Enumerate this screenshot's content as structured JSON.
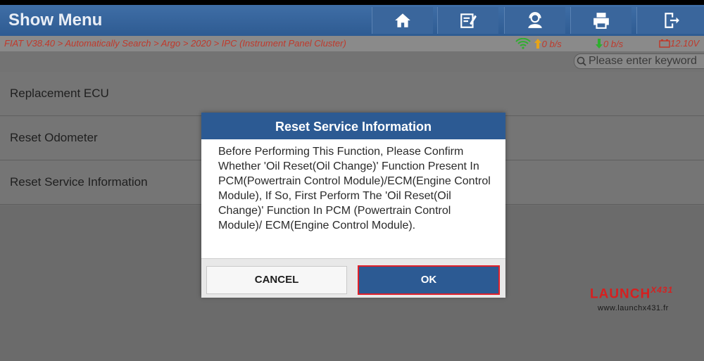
{
  "header": {
    "title": "Show Menu",
    "buttons": [
      "home-icon",
      "edit-icon",
      "user-icon",
      "print-icon",
      "exit-icon"
    ]
  },
  "breadcrumb": "FIAT V38.40 > Automatically Search > Argo > 2020 > IPC (Instrument Panel Cluster)",
  "network": {
    "upload": "0 b/s",
    "download": "0 b/s",
    "battery": "12.10V"
  },
  "search": {
    "placeholder": "Please enter keyword"
  },
  "menu": {
    "items": [
      {
        "label": "Replacement ECU"
      },
      {
        "label": "Reset Odometer"
      },
      {
        "label": "Reset Service Information"
      }
    ]
  },
  "dialog": {
    "title": "Reset Service Information",
    "message": "Before Performing This Function, Please Confirm Whether 'Oil Reset(Oil Change)' Function Present In PCM(Powertrain Control Module)/ECM(Engine Control Module), If So, First Perform The 'Oil Reset(Oil Change)' Function In PCM (Powertrain Control Module)/ ECM(Engine Control Module).",
    "cancel_label": "CANCEL",
    "ok_label": "OK"
  },
  "watermark": {
    "brand": "LAUNCH",
    "brand_suffix": "X431",
    "site": "www.launchx431.fr"
  },
  "colors": {
    "header": "#2e5b92",
    "accent": "#d62020",
    "crumb": "#c0392b"
  }
}
